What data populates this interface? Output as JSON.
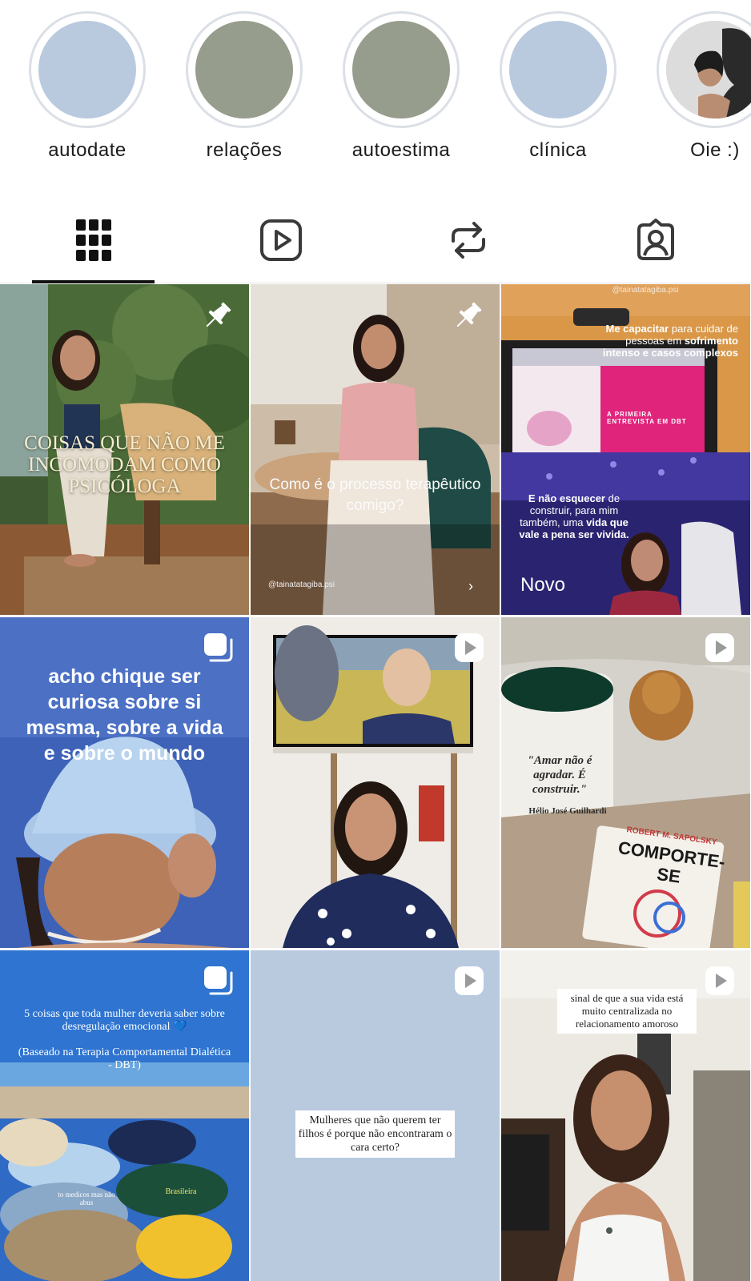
{
  "highlights": [
    {
      "label": "autodate",
      "color": "#b9cadf"
    },
    {
      "label": "relações",
      "color": "#979d8c"
    },
    {
      "label": "autoestima",
      "color": "#979d8c"
    },
    {
      "label": "clínica",
      "color": "#b9cadf"
    },
    {
      "label": "Oie :)",
      "color": "#d9d9d9"
    }
  ],
  "tabs": [
    {
      "name": "posts-grid-icon",
      "active": true
    },
    {
      "name": "reels-icon",
      "active": false
    },
    {
      "name": "reposts-icon",
      "active": false
    },
    {
      "name": "tagged-icon",
      "active": false
    }
  ],
  "posts": [
    {
      "caption": "COISAS QUE NÃO ME INCOMODAM COMO PSICÓLOGA",
      "badge": "pin-icon"
    },
    {
      "caption": "Como é o processo terapêutico comigo?",
      "handle": "@tainatatagiba.psi",
      "badge": "pin-icon"
    },
    {
      "handle": "@tainatatagiba.psi",
      "top_text_bold": "Me capacitar",
      "top_text": "para cuidar de pessoas em",
      "top_text2_bold": "sofrimento intenso e casos complexos",
      "screen_text": "A PRIMEIRA ENTREVISTA EM DBT",
      "bottom_text_bold": "E não esquecer",
      "bottom_text": "de construir, para mim também, uma",
      "bottom_text2_bold": "vida que vale a pena ser vivida.",
      "new_label": "Novo"
    },
    {
      "caption": "acho chique ser curiosa sobre si mesma, sobre a vida e sobre o mundo",
      "badge": "carousel-icon"
    },
    {
      "badge": "reel-icon"
    },
    {
      "mug_text": "\"Amar não é agradar. É construir.\"",
      "mug_author": "Hélio José Guilhardi",
      "book_author": "ROBERT M. SAPOLSKY",
      "book_title": "COMPORTE-SE",
      "badge": "reel-icon"
    },
    {
      "caption": "5 coisas que toda mulher deveria saber sobre desregulação emocional 💙",
      "caption2": "(Baseado na Terapia Comportamental Dialética - DBT)",
      "hat1": "to medicos mas não abus",
      "hat2": "Brasileira",
      "badge": "carousel-icon"
    },
    {
      "caption": "Mulheres que não querem ter filhos é porque não encontraram o cara certo?",
      "badge": "reel-icon"
    },
    {
      "caption": "sinal de que a sua vida está muito centralizada no relacionamento amoroso",
      "badge": "reel-icon"
    }
  ]
}
